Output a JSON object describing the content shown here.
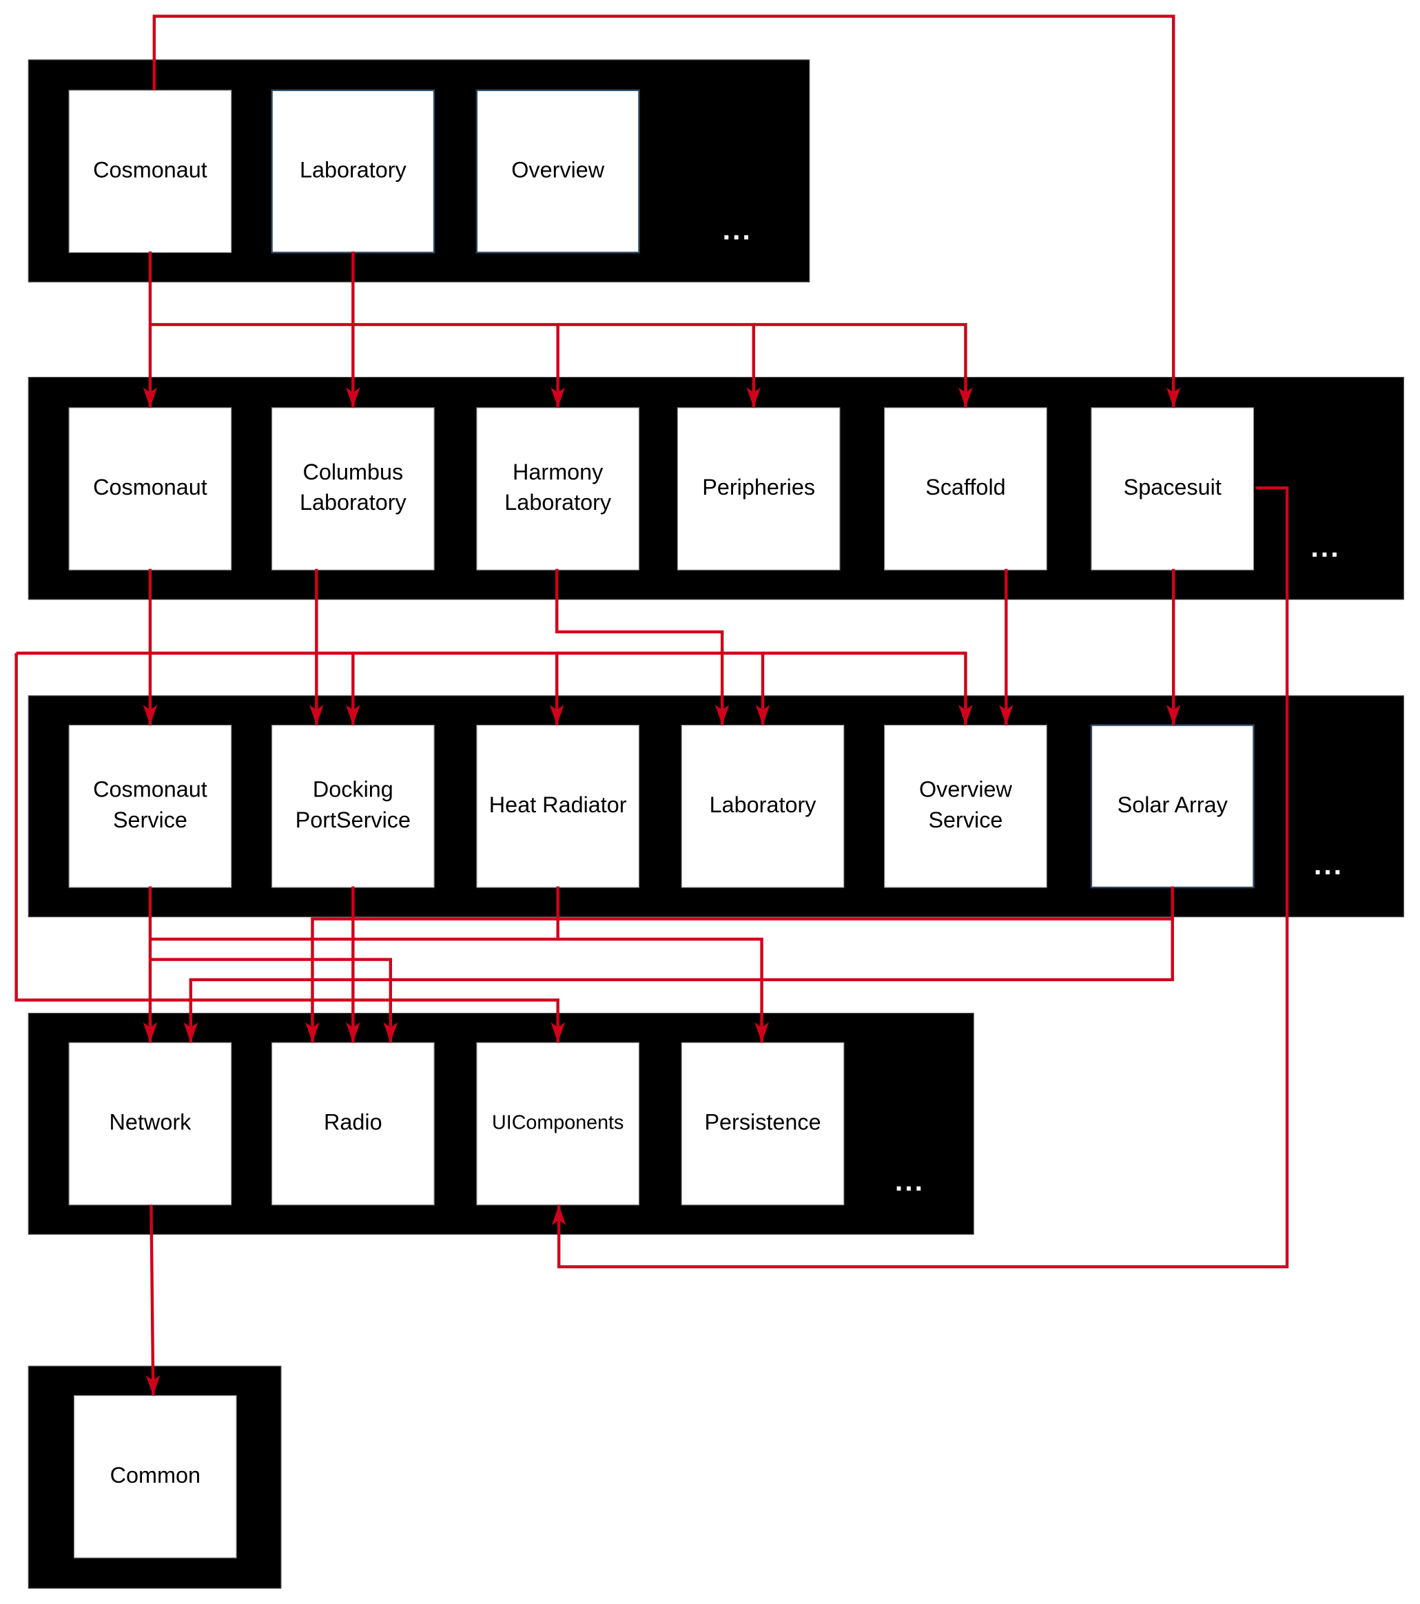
{
  "diagram": {
    "edge_color": "#d0021b",
    "layer_color": "#000000",
    "module_color": "#ffffff",
    "ellipsis": "...",
    "layers": [
      {
        "id": "layer-1",
        "modules": [
          {
            "id": "l1-cosmonaut",
            "lines": [
              "Cosmonaut"
            ]
          },
          {
            "id": "l1-laboratory",
            "lines": [
              "Laboratory"
            ],
            "accent": true
          },
          {
            "id": "l1-overview",
            "lines": [
              "Overview"
            ],
            "accent": true
          }
        ],
        "has_more": true
      },
      {
        "id": "layer-2",
        "modules": [
          {
            "id": "l2-cosmonaut",
            "lines": [
              "Cosmonaut"
            ]
          },
          {
            "id": "l2-columbus-laboratory",
            "lines": [
              "Columbus",
              "Laboratory"
            ]
          },
          {
            "id": "l2-harmony-laboratory",
            "lines": [
              "Harmony",
              "Laboratory"
            ]
          },
          {
            "id": "l2-peripheries",
            "lines": [
              "Peripheries"
            ]
          },
          {
            "id": "l2-scaffold",
            "lines": [
              "Scaffold"
            ]
          },
          {
            "id": "l2-spacesuit",
            "lines": [
              "Spacesuit"
            ]
          }
        ],
        "has_more": true
      },
      {
        "id": "layer-3",
        "modules": [
          {
            "id": "l3-cosmonaut-service",
            "lines": [
              "Cosmonaut",
              "Service"
            ]
          },
          {
            "id": "l3-docking-portservice",
            "lines": [
              "Docking",
              "PortService"
            ]
          },
          {
            "id": "l3-heat-radiator",
            "lines": [
              "Heat Radiator"
            ]
          },
          {
            "id": "l3-laboratory",
            "lines": [
              "Laboratory"
            ]
          },
          {
            "id": "l3-overview-service",
            "lines": [
              "Overview",
              "Service"
            ]
          },
          {
            "id": "l3-solar-array",
            "lines": [
              "Solar Array"
            ],
            "accent": true
          }
        ],
        "has_more": true
      },
      {
        "id": "layer-4",
        "modules": [
          {
            "id": "l4-network",
            "lines": [
              "Network"
            ]
          },
          {
            "id": "l4-radio",
            "lines": [
              "Radio"
            ]
          },
          {
            "id": "l4-uicomponents",
            "lines": [
              "UIComponents"
            ],
            "small": true
          },
          {
            "id": "l4-persistence",
            "lines": [
              "Persistence"
            ]
          }
        ],
        "has_more": true
      },
      {
        "id": "layer-5",
        "modules": [
          {
            "id": "l5-common",
            "lines": [
              "Common"
            ]
          }
        ],
        "has_more": false
      }
    ],
    "dependencies": [
      {
        "from": "l1-cosmonaut",
        "to": "l2-spacesuit"
      },
      {
        "from": "l1-cosmonaut",
        "to": "l2-cosmonaut"
      },
      {
        "from": "l1-cosmonaut",
        "to": "l2-harmony-laboratory"
      },
      {
        "from": "l1-cosmonaut",
        "to": "l2-peripheries"
      },
      {
        "from": "l1-cosmonaut",
        "to": "l2-scaffold"
      },
      {
        "from": "l1-laboratory",
        "to": "l2-columbus-laboratory"
      },
      {
        "from": "l2-cosmonaut",
        "to": "l3-cosmonaut-service"
      },
      {
        "from": "l2-columbus-laboratory",
        "to": "l3-docking-portservice"
      },
      {
        "from": "l2-harmony-laboratory",
        "to": "l3-laboratory"
      },
      {
        "from": "shared-bus",
        "to": "l3-docking-portservice"
      },
      {
        "from": "shared-bus",
        "to": "l3-heat-radiator"
      },
      {
        "from": "shared-bus",
        "to": "l3-laboratory"
      },
      {
        "from": "shared-bus",
        "to": "l3-overview-service"
      },
      {
        "from": "shared-bus",
        "to": "l4-uicomponents"
      },
      {
        "from": "l2-scaffold",
        "to": "l3-overview-service"
      },
      {
        "from": "l2-spacesuit",
        "to": "l3-solar-array"
      },
      {
        "from": "l2-spacesuit",
        "to": "l4-uicomponents"
      },
      {
        "from": "l3-cosmonaut-service",
        "to": "l4-network"
      },
      {
        "from": "l3-cosmonaut-service",
        "to": "l4-radio"
      },
      {
        "from": "l3-docking-portservice",
        "to": "l4-radio"
      },
      {
        "from": "l3-heat-radiator",
        "to": "l4-persistence"
      },
      {
        "from": "l3-solar-array",
        "to": "l4-radio"
      },
      {
        "from": "l3-solar-array",
        "to": "l4-network"
      },
      {
        "from": "l4-network",
        "to": "l5-common"
      }
    ]
  }
}
